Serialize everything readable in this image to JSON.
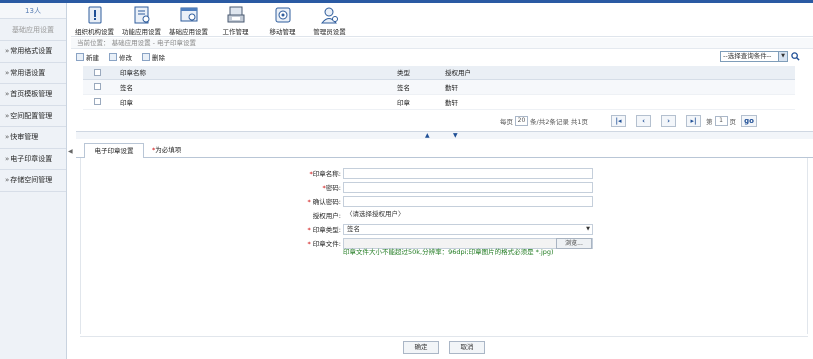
{
  "sidebar": {
    "user": "13人",
    "subtitle": "基础应用设置",
    "items": [
      {
        "label": "常用格式设置"
      },
      {
        "label": "常用语设置"
      },
      {
        "label": "首页模板管理"
      },
      {
        "label": "空间配置管理"
      },
      {
        "label": "快审管理"
      },
      {
        "label": "电子印章设置"
      },
      {
        "label": "存储空间管理"
      }
    ]
  },
  "toolbar": {
    "items": [
      {
        "label": "组织机构设置",
        "icon": "org-icon"
      },
      {
        "label": "功能应用设置",
        "icon": "app-icon"
      },
      {
        "label": "基础应用设置",
        "icon": "base-icon"
      },
      {
        "label": "工作管理",
        "icon": "work-icon"
      },
      {
        "label": "移动管理",
        "icon": "mobile-icon"
      },
      {
        "label": "管理员设置",
        "icon": "admin-icon"
      }
    ]
  },
  "breadcrumb": "当前位置： 基础应用设置 - 电子印章设置",
  "actions": {
    "new_label": "新建",
    "edit_label": "修改",
    "delete_label": "删除",
    "query_select": "--选择查询条件--"
  },
  "table": {
    "headers": [
      "印章名称",
      "类型",
      "授权用户"
    ],
    "rows": [
      {
        "name": "签名",
        "type": "签名",
        "user": "勤轩"
      },
      {
        "name": "印章",
        "type": "印章",
        "user": "勤轩"
      }
    ]
  },
  "pager": {
    "per_page_prefix": "每页",
    "per_page": "20",
    "summary": "条/共2条记录  共1页",
    "page_prefix": "第",
    "page": "1",
    "page_suffix": "页",
    "go": "go"
  },
  "tabs": {
    "active": "电子印章设置",
    "note_star": "*",
    "note": "为必填项"
  },
  "form": {
    "name_label": "印章名称:",
    "password_label": "密码:",
    "confirm_label": "确认密码:",
    "auth_label": "授权用户:",
    "auth_value": "〈请选择授权用户〉",
    "type_label": "印章类型:",
    "type_value": "签名",
    "file_label": "印章文件:",
    "browse": "浏览...",
    "hint": "印章文件大小不能超过50k,分辨率：96dpi;印章图片的格式必须是 *.jpg)"
  },
  "footer": {
    "ok": "确定",
    "cancel": "取消"
  },
  "colors": {
    "accent": "#2a5aa3",
    "required": "#cc0000",
    "hint": "#1f7a1f"
  }
}
